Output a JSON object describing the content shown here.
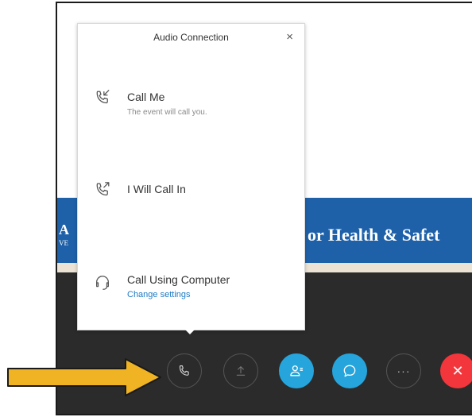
{
  "popup": {
    "title": "Audio Connection",
    "close_symbol": "×",
    "options": [
      {
        "label": "Call Me",
        "sub": "The event will call you.",
        "icon": "call-me-icon"
      },
      {
        "label": "I Will Call In",
        "icon": "call-in-icon"
      },
      {
        "label": "Call Using Computer",
        "link": "Change settings",
        "icon": "headset-icon"
      }
    ]
  },
  "banner": {
    "text": "or Health & Safet",
    "left_text": "A",
    "left_sub": "VE"
  },
  "toolbar": {
    "buttons": [
      {
        "name": "audio-button",
        "icon": "phone-icon"
      },
      {
        "name": "share-button",
        "icon": "upload-icon"
      },
      {
        "name": "participants-button",
        "icon": "participants-icon"
      },
      {
        "name": "chat-button",
        "icon": "chat-icon"
      },
      {
        "name": "more-button",
        "icon": "more-icon",
        "label": "···"
      },
      {
        "name": "leave-button",
        "icon": "close-icon",
        "label": "✕"
      }
    ]
  },
  "colors": {
    "banner": "#1e61a9",
    "toolbar_bg": "#2b2b2b",
    "accent_blue": "#26a5dc",
    "leave_red": "#f2363b",
    "link": "#1e7bc4",
    "arrow": "#f0b323"
  }
}
